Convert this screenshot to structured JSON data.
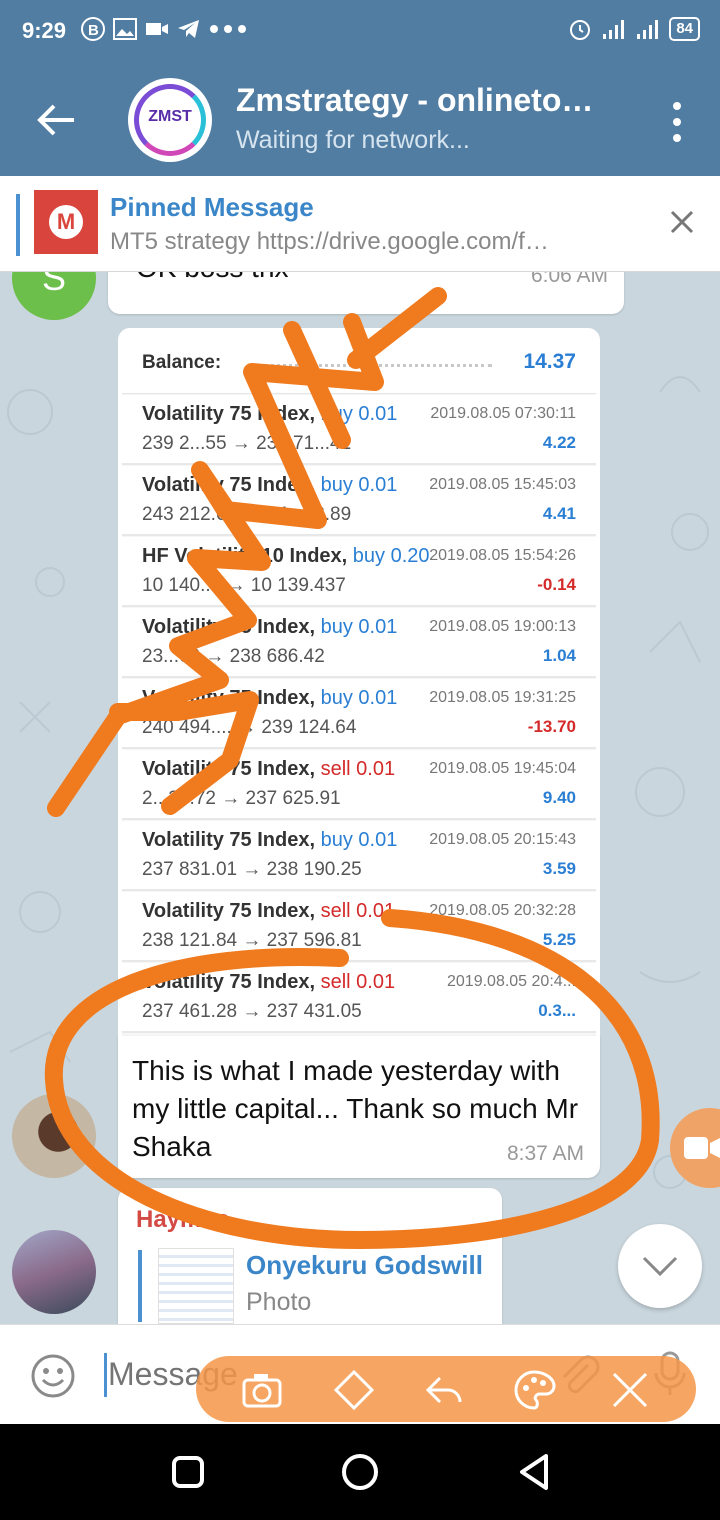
{
  "status_bar": {
    "time": "9:29",
    "battery": "84"
  },
  "header": {
    "avatar_text": "ZMST",
    "title": "Zmstrategy - onlineto…",
    "subtitle": "Waiting for network..."
  },
  "pinned": {
    "title": "Pinned Message",
    "text": "MT5 strategy  https://drive.google.com/f…",
    "thumb_letter": "M"
  },
  "messages": {
    "first": {
      "avatar_letter": "S",
      "text": "OK boss thx",
      "time": "6:06 AM"
    },
    "shot": {
      "balance_label": "Balance:",
      "balance_value": "14.37",
      "trades": [
        {
          "name": "Volatility 75 Index,",
          "action": "buy 0.01",
          "prices": "239 2...55 → 239 71...41",
          "date": "2019.08.05 07:30:11",
          "pl": "4.22"
        },
        {
          "name": "Volatility 75 Index,",
          "action": "buy 0.01",
          "prices": "243 212.66 → 24...53.89",
          "date": "2019.08.05 15:45:03",
          "pl": "4.41"
        },
        {
          "name": "HF Volatility 10 Index,",
          "action": "buy 0.20",
          "prices": "10 140.... → 10 139.437",
          "date": "2019.08.05 15:54:26",
          "pl": "-0.14"
        },
        {
          "name": "Volatility 75 Index,",
          "action": "buy 0.01",
          "prices": "23...60 → 238 686.42",
          "date": "2019.08.05 19:00:13",
          "pl": "1.04"
        },
        {
          "name": "Volatility 75 Index,",
          "action": "buy 0.01",
          "prices": "240 494.... → 239 124.64",
          "date": "2019.08.05 19:31:25",
          "pl": "-13.70"
        },
        {
          "name": "Volatility 75 Index,",
          "action": "sell 0.01",
          "prices": "2...35.72 → 237 625.91",
          "date": "2019.08.05 19:45:04",
          "pl": "9.40"
        },
        {
          "name": "Volatility 75 Index,",
          "action": "buy 0.01",
          "prices": "237 831.01 → 238 190.25",
          "date": "2019.08.05 20:15:43",
          "pl": "3.59"
        },
        {
          "name": "Volatility 75 Index,",
          "action": "sell 0.01",
          "prices": "238 121.84 → 237 596.81",
          "date": "2019.08.05 20:32:28",
          "pl": "5.25"
        },
        {
          "name": "Volatility 75 Index,",
          "action": "sell 0.01",
          "prices": "237 461.28 → 237 431.05",
          "date": "2019.08.05 20:4...",
          "pl": "0.3..."
        }
      ]
    },
    "caption": {
      "text": "This is what I made yesterday with my little capital... Thank so much Mr Shaka",
      "time": "8:37 AM"
    },
    "reply": {
      "sender": "Haymos",
      "quoted_name": "Onyekuru Godswill",
      "quoted_type": "Photo"
    }
  },
  "input": {
    "placeholder": "Message"
  },
  "colors": {
    "header": "#517da2",
    "accent": "#4b91d2",
    "annotation": "#f07a1e",
    "profit": "#2a7fd4",
    "loss": "#d42a2a"
  }
}
